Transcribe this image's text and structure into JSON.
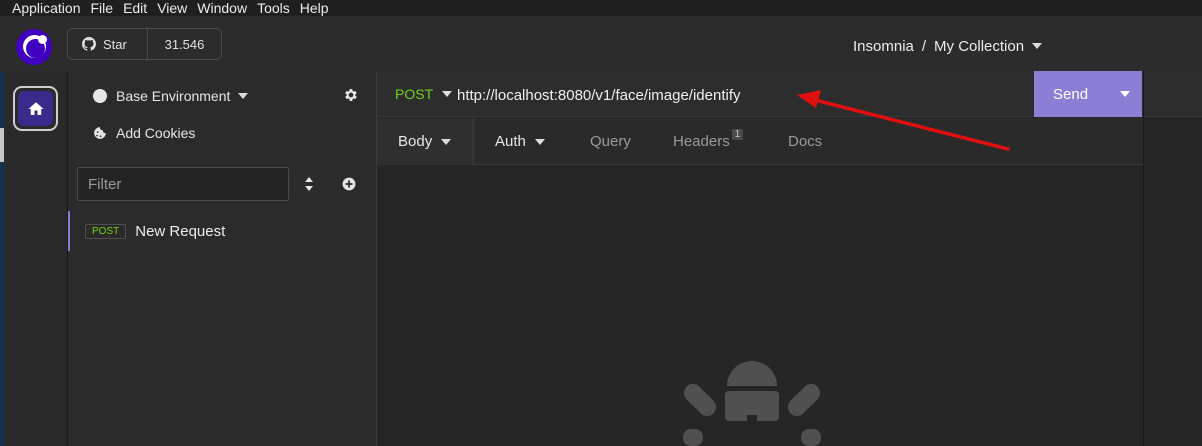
{
  "menu": [
    "Application",
    "File",
    "Edit",
    "View",
    "Window",
    "Tools",
    "Help"
  ],
  "header": {
    "star_label": "Star",
    "star_count": "31.546",
    "breadcrumb_project": "Insomnia",
    "breadcrumb_separator": "/",
    "breadcrumb_collection": "My Collection"
  },
  "sidebar": {
    "environment": "Base Environment",
    "add_cookies": "Add Cookies",
    "filter_placeholder": "Filter",
    "requests": [
      {
        "method": "POST",
        "name": "New Request"
      }
    ]
  },
  "request": {
    "method": "POST",
    "url": "http://localhost:8080/v1/face/image/identify",
    "send_label": "Send",
    "tabs": {
      "body": "Body",
      "auth": "Auth",
      "query": "Query",
      "headers": "Headers",
      "headers_count": "1",
      "docs": "Docs"
    }
  },
  "colors": {
    "accent": "#8a7fd4",
    "method_post": "#73d216",
    "annotation_arrow": "#e01010"
  },
  "icons": [
    "logo-icon",
    "github-icon",
    "home-icon",
    "gear-icon",
    "cookie-icon",
    "sort-icon",
    "add-circle-icon",
    "chevron-down-icon",
    "empty-state-icon",
    "annotation-arrow"
  ]
}
